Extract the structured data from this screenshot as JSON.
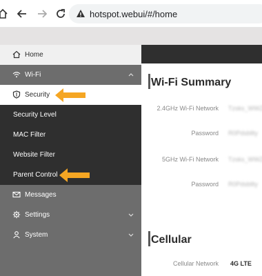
{
  "browser": {
    "url": "hotspot.webui/#/home"
  },
  "sidebar": {
    "items": [
      {
        "label": "Home",
        "icon": "home-icon",
        "style": "light"
      },
      {
        "label": "Wi-Fi",
        "icon": "wifi-icon",
        "style": "gray",
        "chevron": "up"
      },
      {
        "label": "Security",
        "icon": "shield-icon",
        "style": "selected"
      },
      {
        "label": "Security Level",
        "style": "dark"
      },
      {
        "label": "MAC Filter",
        "style": "dark"
      },
      {
        "label": "Website Filter",
        "style": "dark"
      },
      {
        "label": "Parent Control",
        "style": "dark"
      },
      {
        "label": "Messages",
        "icon": "envelope-icon",
        "style": "gray"
      },
      {
        "label": "Settings",
        "icon": "gear-icon",
        "style": "gray",
        "chevron": "down"
      },
      {
        "label": "System",
        "icon": "user-icon",
        "style": "gray",
        "chevron": "down"
      }
    ]
  },
  "wifi_summary": {
    "title": "Wi-Fi Summary",
    "rows": [
      {
        "label": "2.4GHz Wi-Fi Network",
        "value": "Tzsks_WWZ"
      },
      {
        "label": "Password",
        "value": "R0Pdsbllty"
      },
      {
        "label": "5GHz Wi-Fi Network",
        "value": "Tzsks_WWZ"
      },
      {
        "label": "Password",
        "value": "R0Pdsbllty"
      }
    ]
  },
  "cellular": {
    "title": "Cellular",
    "network_label": "Cellular Network",
    "network_value": "4G LTE"
  },
  "colors": {
    "arrow": "#f5a623",
    "sidebar_dark": "#2f2f2f",
    "sidebar_gray": "#6d6d6d"
  }
}
